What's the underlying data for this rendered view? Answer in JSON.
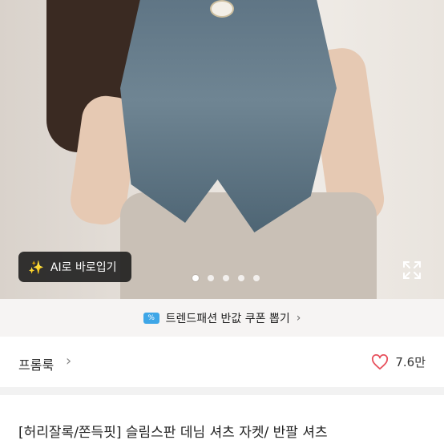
{
  "hero": {
    "ai_button_label": "AI로 바로입기",
    "carousel_dots": 5,
    "active_dot": 0
  },
  "coupon": {
    "ticket_icon_text": "%",
    "label": "트렌드패션 반값 쿠폰 뽑기",
    "chevron": "›"
  },
  "shop": {
    "name": "프롬룩",
    "chevron": "›",
    "likes": "7.6만"
  },
  "product": {
    "title": "[허리잘록/쫀득핏] 슬림스판 데님 셔츠 자켓/ 반팔 셔츠"
  },
  "colors": {
    "heart": "#e8525e",
    "coupon_bg": "#f6f4f3",
    "ticket": "#3ea6e7"
  }
}
